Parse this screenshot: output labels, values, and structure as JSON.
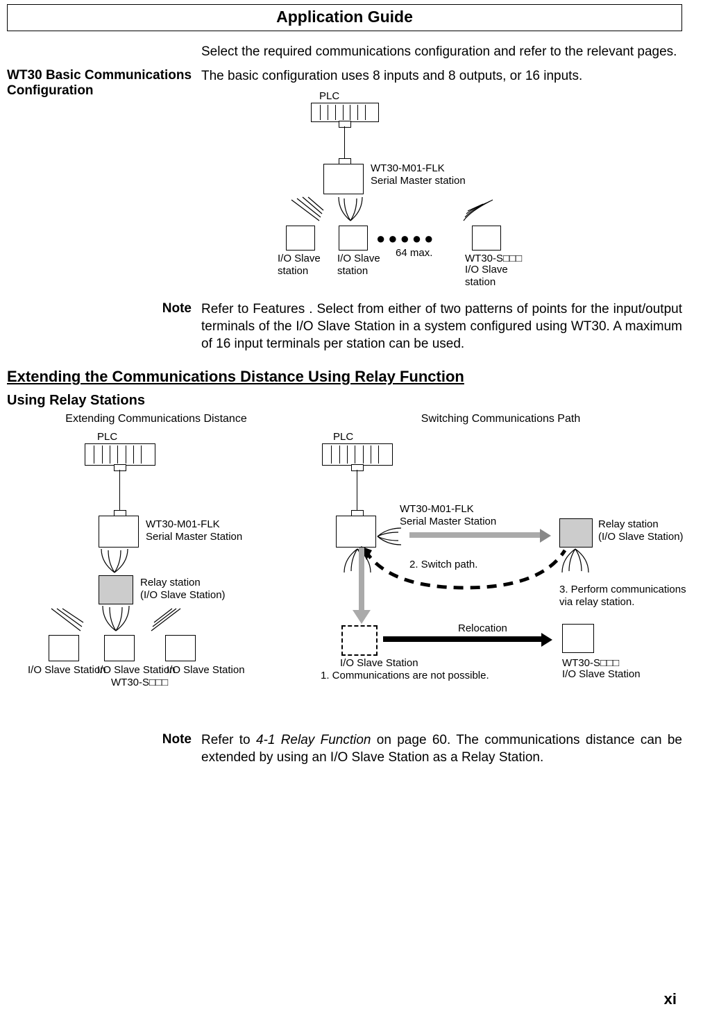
{
  "title": "Application Guide",
  "intro": "Select the required communications configuration and refer to the relevant pages.",
  "side1": "WT30 Basic Communications Configuration",
  "basic_text": "The basic configuration uses 8 inputs and 8 outputs, or 16 inputs.",
  "diagram1": {
    "plc": "PLC",
    "master": "WT30-M01-FLK\nSerial Master station",
    "slave1": "I/O Slave\nstation",
    "slave2": "I/O Slave\nstation",
    "max": "64 max.",
    "slave3_model": "WT30-S□□□",
    "slave3": "I/O Slave\nstation"
  },
  "note1_label": "Note",
  "note1": "Refer to Features . Select from either of two patterns of points for the input/output terminals of the I/O Slave Station in a system configured using WT30. A maximum of 16 input terminals per station can be used.",
  "section_heading": "Extending the Communications Distance Using Relay Function",
  "sub_heading": "Using Relay Stations",
  "relay_left": {
    "caption": "Extending Communications Distance",
    "plc": "PLC",
    "master": "WT30-M01-FLK\nSerial Master Station",
    "relay": "Relay station\n(I/O Slave Station)",
    "slave_a": "I/O Slave Station",
    "slave_b": "I/O Slave Station",
    "slave_c": "I/O Slave Station",
    "model": "WT30-S□□□"
  },
  "relay_right": {
    "caption": "Switching Communications Path",
    "plc": "PLC",
    "master": "WT30-M01-FLK\nSerial Master Station",
    "relay": "Relay station\n(I/O Slave Station)",
    "step2": "2. Switch path.",
    "step3": "3. Perform communications\nvia relay station.",
    "relocation": "Relocation",
    "slave_a": "I/O Slave Station",
    "step1": "1. Communications are not possible.",
    "model": "WT30-S□□□",
    "slave_b": "I/O Slave Station"
  },
  "note2_label": "Note",
  "note2_pre": "Refer to ",
  "note2_ref": "4-1 Relay Function",
  "note2_post": " on page 60. The communications distance can be extended by using an I/O Slave Station as a Relay Station.",
  "page_number": "xi"
}
